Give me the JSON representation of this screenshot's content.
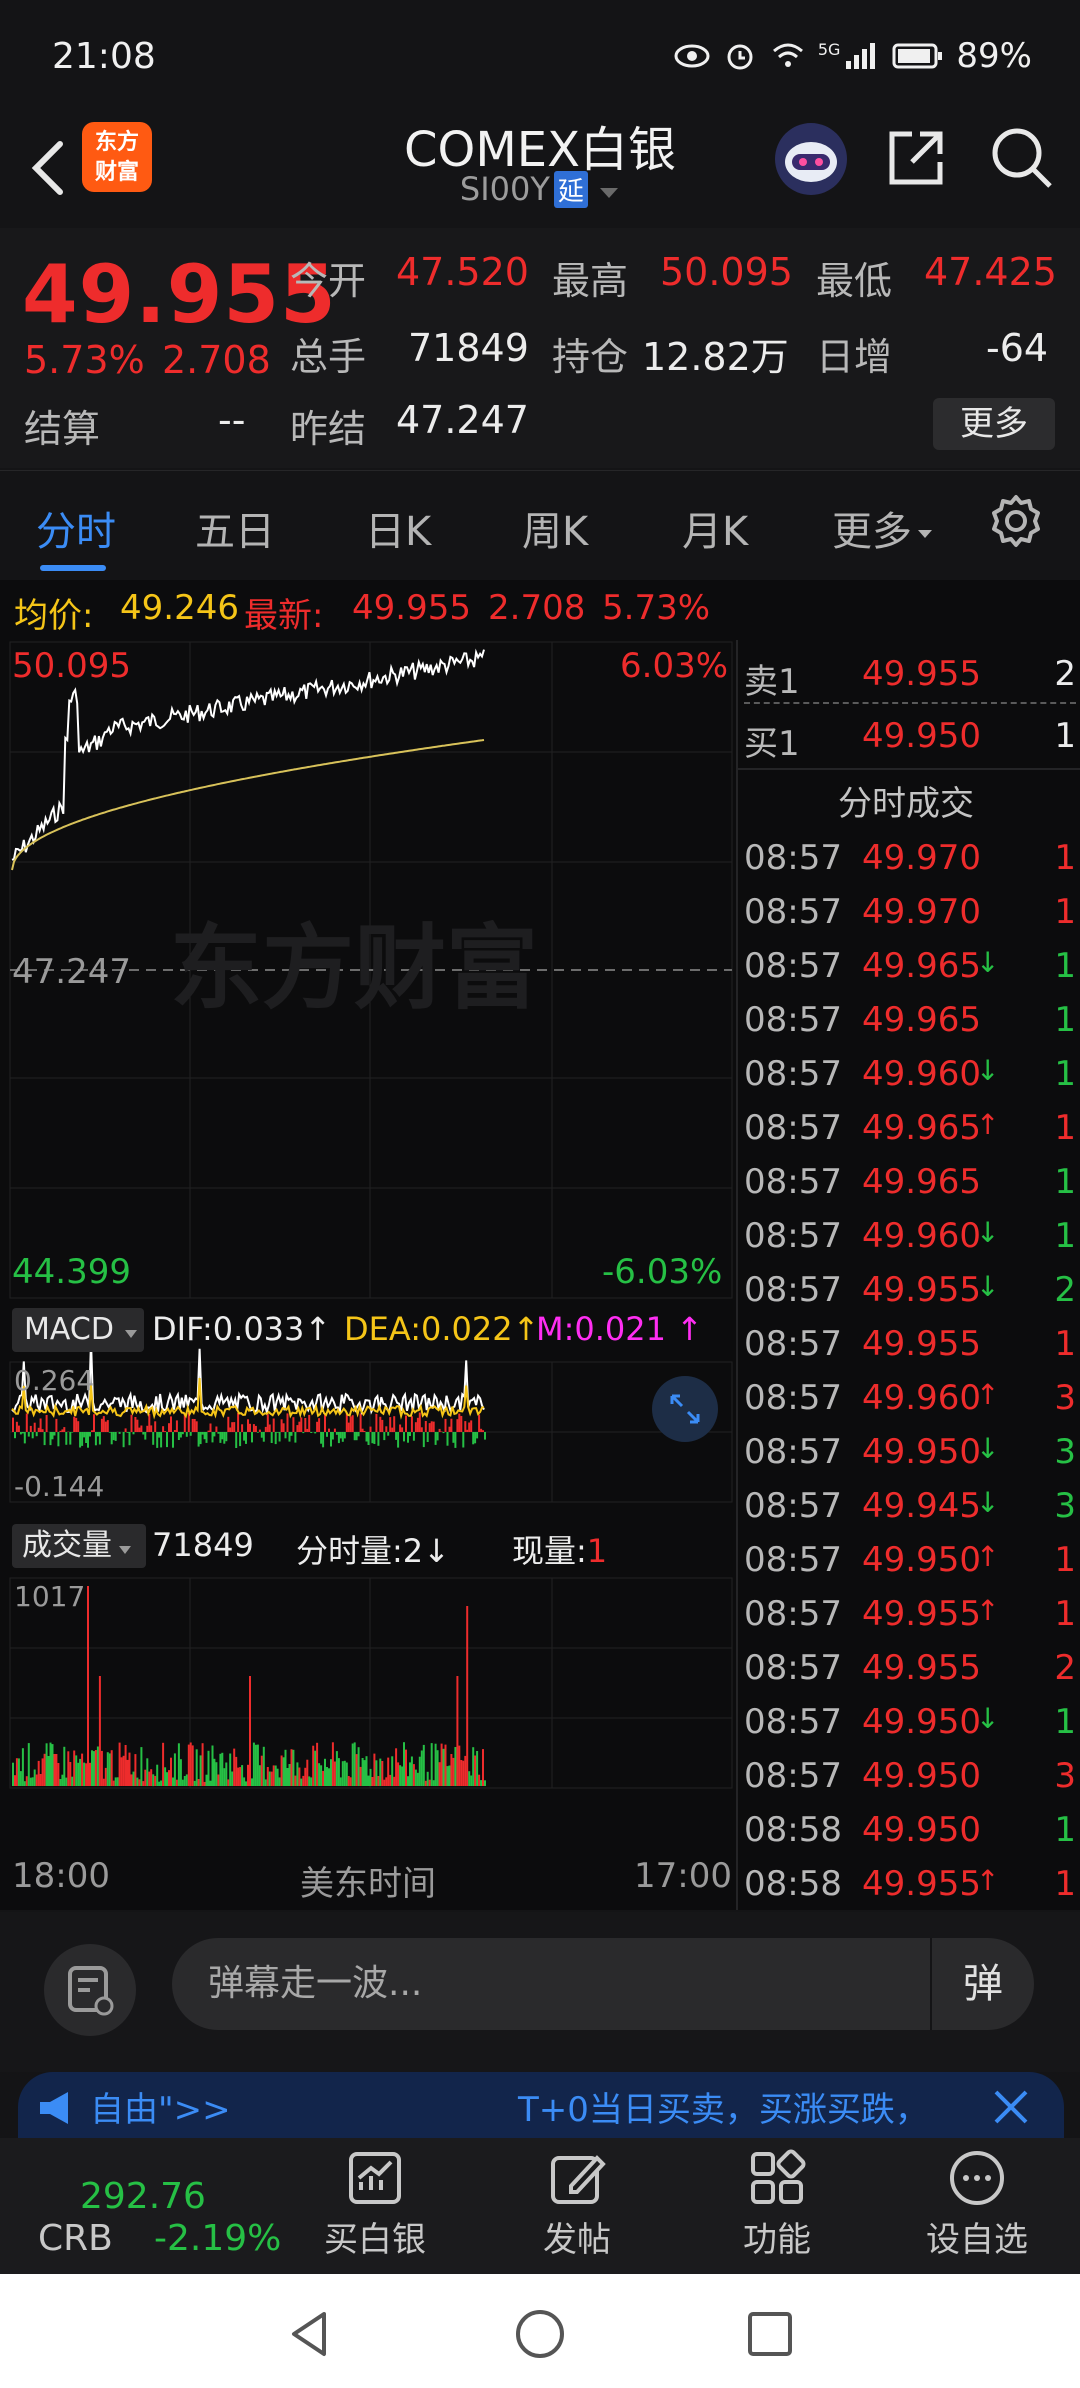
{
  "status_bar": {
    "time": "21:08",
    "signal": "5G",
    "battery": "89%"
  },
  "header": {
    "title": "COMEX白银",
    "subtitle": "SI00Y",
    "delay_badge": "延",
    "logo_line1": "东方",
    "logo_line2": "财富"
  },
  "quote": {
    "price": "49.955",
    "change_pct": "5.73%",
    "change_abs": "2.708",
    "open_label": "今开",
    "open": "47.520",
    "high_label": "最高",
    "high": "50.095",
    "low_label": "最低",
    "low": "47.425",
    "volume_label": "总手",
    "volume": "71849",
    "position_label": "持仓",
    "position": "12.82万",
    "daily_inc_label": "日增",
    "daily_inc": "-64",
    "settle_label": "结算",
    "settle": "--",
    "prev_settle_label": "昨结",
    "prev_settle": "47.247",
    "more_label": "更多"
  },
  "tabs": [
    "分时",
    "五日",
    "日K",
    "周K",
    "月K",
    "更多"
  ],
  "avg_line": {
    "avg_label": "均价:",
    "avg": "49.246",
    "latest_label": "最新:",
    "latest": "49.955",
    "change": "2.708",
    "pct": "5.73%"
  },
  "chart": {
    "y_top": "50.095",
    "y_mid": "47.247",
    "y_bottom": "44.399",
    "pct_top": "6.03%",
    "pct_bottom": "-6.03%",
    "watermark": "东方财富",
    "macd_label": "MACD",
    "dif": "DIF:0.033",
    "dea": "DEA:0.022",
    "m": "M:0.021",
    "macd_top": "0.264",
    "macd_bottom": "-0.144",
    "vol_label": "成交量",
    "vol_total": "71849",
    "vol_minute": "分时量:2",
    "vol_now_label": "现量:",
    "vol_now": "1",
    "vol_max": "1017",
    "time_start": "18:00",
    "time_label": "美东时间",
    "time_end": "17:00"
  },
  "order_book": {
    "sell1_label": "卖1",
    "sell1_price": "49.955",
    "sell1_vol": "2",
    "buy1_label": "买1",
    "buy1_price": "49.950",
    "buy1_vol": "1",
    "trades_title": "分时成交",
    "trades": [
      {
        "t": "08:57",
        "p": "49.970",
        "a": "",
        "v": "1",
        "c": "red"
      },
      {
        "t": "08:57",
        "p": "49.970",
        "a": "",
        "v": "1",
        "c": "red"
      },
      {
        "t": "08:57",
        "p": "49.965",
        "a": "↓",
        "v": "1",
        "c": "green"
      },
      {
        "t": "08:57",
        "p": "49.965",
        "a": "",
        "v": "1",
        "c": "green"
      },
      {
        "t": "08:57",
        "p": "49.960",
        "a": "↓",
        "v": "1",
        "c": "green"
      },
      {
        "t": "08:57",
        "p": "49.965",
        "a": "↑",
        "v": "1",
        "c": "red"
      },
      {
        "t": "08:57",
        "p": "49.965",
        "a": "",
        "v": "1",
        "c": "green"
      },
      {
        "t": "08:57",
        "p": "49.960",
        "a": "↓",
        "v": "1",
        "c": "green"
      },
      {
        "t": "08:57",
        "p": "49.955",
        "a": "↓",
        "v": "2",
        "c": "green"
      },
      {
        "t": "08:57",
        "p": "49.955",
        "a": "",
        "v": "1",
        "c": "red"
      },
      {
        "t": "08:57",
        "p": "49.960",
        "a": "↑",
        "v": "3",
        "c": "red"
      },
      {
        "t": "08:57",
        "p": "49.950",
        "a": "↓",
        "v": "3",
        "c": "green"
      },
      {
        "t": "08:57",
        "p": "49.945",
        "a": "↓",
        "v": "3",
        "c": "green"
      },
      {
        "t": "08:57",
        "p": "49.950",
        "a": "↑",
        "v": "1",
        "c": "red"
      },
      {
        "t": "08:57",
        "p": "49.955",
        "a": "↑",
        "v": "1",
        "c": "red"
      },
      {
        "t": "08:57",
        "p": "49.955",
        "a": "",
        "v": "2",
        "c": "red"
      },
      {
        "t": "08:57",
        "p": "49.950",
        "a": "↓",
        "v": "1",
        "c": "green"
      },
      {
        "t": "08:57",
        "p": "49.950",
        "a": "",
        "v": "3",
        "c": "red"
      },
      {
        "t": "08:58",
        "p": "49.950",
        "a": "",
        "v": "1",
        "c": "green"
      },
      {
        "t": "08:58",
        "p": "49.955",
        "a": "↑",
        "v": "1",
        "c": "red"
      }
    ]
  },
  "comment": {
    "placeholder": "弹幕走一波...",
    "send": "弹"
  },
  "notice": {
    "left": "自由\">>",
    "right": "T+0当日买卖，买涨买跌，"
  },
  "bottom_nav": {
    "crb_price": "292.76",
    "crb_label": "CRB",
    "crb_change": "-2.19%",
    "items": [
      "买白银",
      "发帖",
      "功能",
      "设自选"
    ]
  },
  "colors": {
    "up": "#ee2c2c",
    "down": "#26c045",
    "accent": "#3b8cf5",
    "price_line": "#ffffff",
    "avg_line": "#d8c25a"
  }
}
